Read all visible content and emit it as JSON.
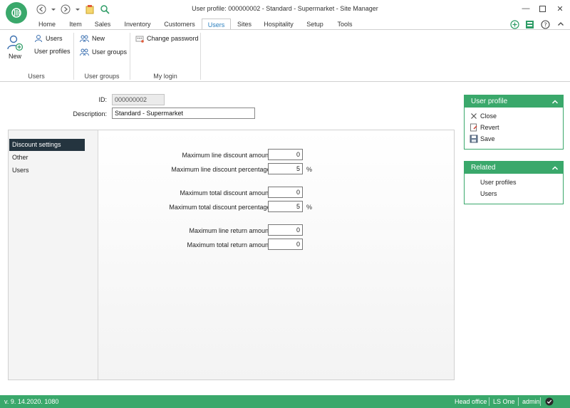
{
  "window": {
    "title": "User profile: 000000002 - Standard - Supermarket - Site Manager"
  },
  "tabs": [
    {
      "label": "Home"
    },
    {
      "label": "Item"
    },
    {
      "label": "Sales"
    },
    {
      "label": "Inventory"
    },
    {
      "label": "Customers"
    },
    {
      "label": "Users"
    },
    {
      "label": "Sites"
    },
    {
      "label": "Hospitality"
    },
    {
      "label": "Setup"
    },
    {
      "label": "Tools"
    }
  ],
  "active_tab": "Users",
  "ribbon": {
    "new_label": "New",
    "users_label": "Users",
    "user_profiles_label": "User profiles",
    "group_new_label": "New",
    "user_groups_label": "User groups",
    "change_password_label": "Change password",
    "group_users": "Users",
    "group_user_groups": "User groups",
    "group_my_login": "My login"
  },
  "form": {
    "id_label": "ID:",
    "id_value": "000000002",
    "description_label": "Description:",
    "description_value": "Standard - Supermarket"
  },
  "left_nav": [
    {
      "label": "Discount settings",
      "selected": true
    },
    {
      "label": "Other",
      "selected": false
    },
    {
      "label": "Users",
      "selected": false
    }
  ],
  "discount_fields": [
    {
      "label": "Maximum line discount amount:",
      "value": "0",
      "unit": ""
    },
    {
      "label": "Maximum line discount percentage:",
      "value": "5",
      "unit": "%"
    },
    {
      "label": "Maximum total discount amount:",
      "value": "0",
      "unit": ""
    },
    {
      "label": "Maximum total discount percentage:",
      "value": "5",
      "unit": "%"
    },
    {
      "label": "Maximum line return amount:",
      "value": "0",
      "unit": ""
    },
    {
      "label": "Maximum total return amount:",
      "value": "0",
      "unit": ""
    }
  ],
  "side_user_profile": {
    "title": "User profile",
    "items": [
      {
        "label": "Close",
        "icon": "close-icon"
      },
      {
        "label": "Revert",
        "icon": "revert-icon"
      },
      {
        "label": "Save",
        "icon": "save-icon"
      }
    ]
  },
  "side_related": {
    "title": "Related",
    "items": [
      {
        "label": "User profiles"
      },
      {
        "label": "Users"
      }
    ]
  },
  "status": {
    "version": "v. 9. 14.2020. 1080",
    "store": "Head office",
    "product": "LS One",
    "user": "admin"
  },
  "colors": {
    "accent_green": "#3aa86b",
    "selected_nav": "#24343f",
    "active_tab_text": "#2a7fbf"
  }
}
